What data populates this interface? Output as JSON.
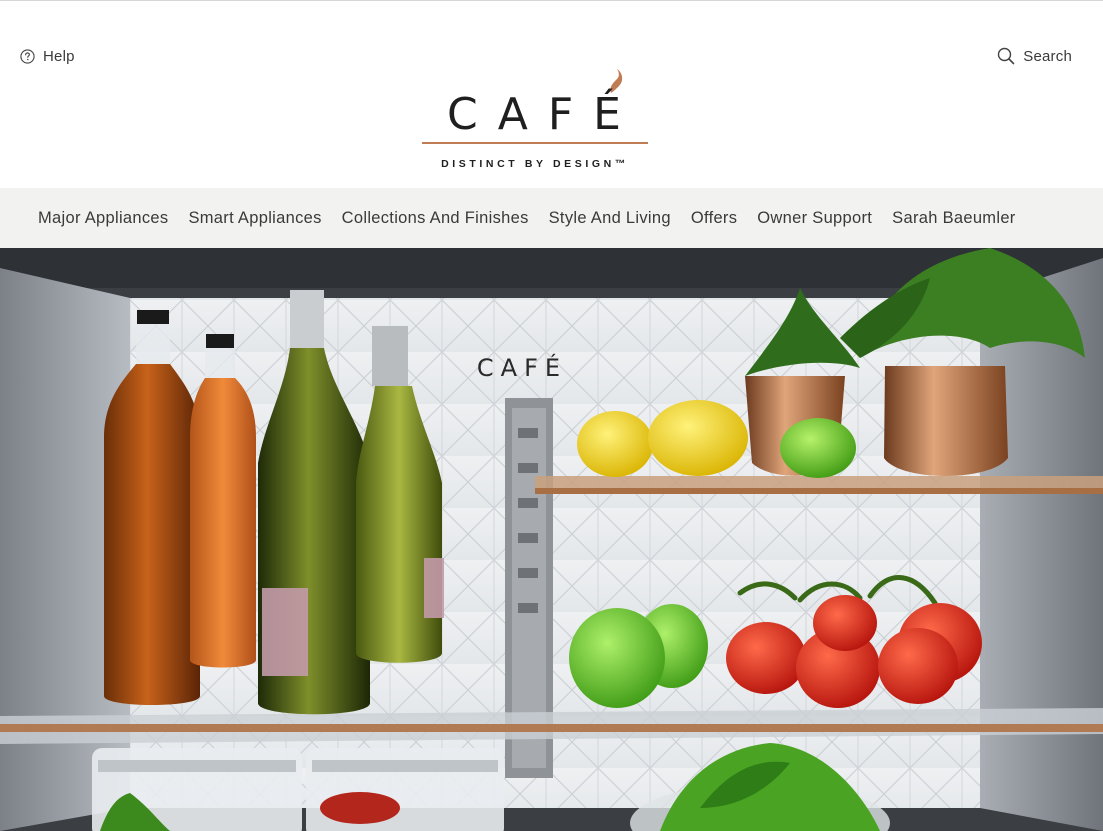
{
  "header": {
    "help_label": "Help",
    "search_label": "Search",
    "help_icon": "question-circle-icon",
    "search_icon": "magnifier-icon"
  },
  "logo": {
    "wordmark": "CAFÉ",
    "tagline": "DISTINCT BY DESIGN™",
    "accent_color": "#c07c55"
  },
  "nav": {
    "items": [
      {
        "label": "Major Appliances"
      },
      {
        "label": "Smart Appliances"
      },
      {
        "label": "Collections And Finishes"
      },
      {
        "label": "Style And Living"
      },
      {
        "label": "Offers"
      },
      {
        "label": "Owner Support"
      },
      {
        "label": "Sarah Baeumler"
      }
    ],
    "background": "#f2f2f0"
  },
  "hero": {
    "wall_logo": "CAFÉ"
  }
}
